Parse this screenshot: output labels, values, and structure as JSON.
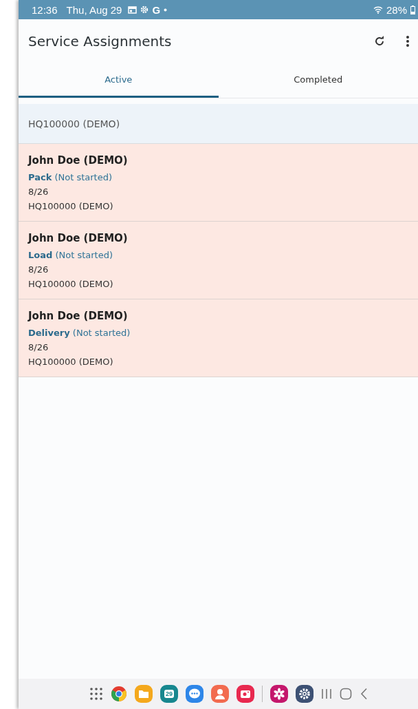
{
  "status_bar": {
    "time": "12:36",
    "date": "Thu, Aug 29",
    "google": "G",
    "battery": "28%"
  },
  "app_bar": {
    "title": "Service Assignments"
  },
  "tabs": [
    {
      "label": "Active",
      "selected": true
    },
    {
      "label": "Completed",
      "selected": false
    }
  ],
  "group": {
    "title": "HQ100000 (DEMO)"
  },
  "assignments": [
    {
      "name": "John Doe (DEMO)",
      "task": "**Pack** (Not started)",
      "date": "8/26",
      "location": "HQ100000 (DEMO)"
    },
    {
      "name": "John Doe (DEMO)",
      "task": "**Load** (Not started)",
      "date": "8/26",
      "location": "HQ100000 (DEMO)"
    },
    {
      "name": "John Doe (DEMO)",
      "task": "**Delivery** (Not started)",
      "date": "8/26",
      "location": "HQ100000 (DEMO)"
    }
  ],
  "dock": {
    "calendar_day": "29"
  }
}
